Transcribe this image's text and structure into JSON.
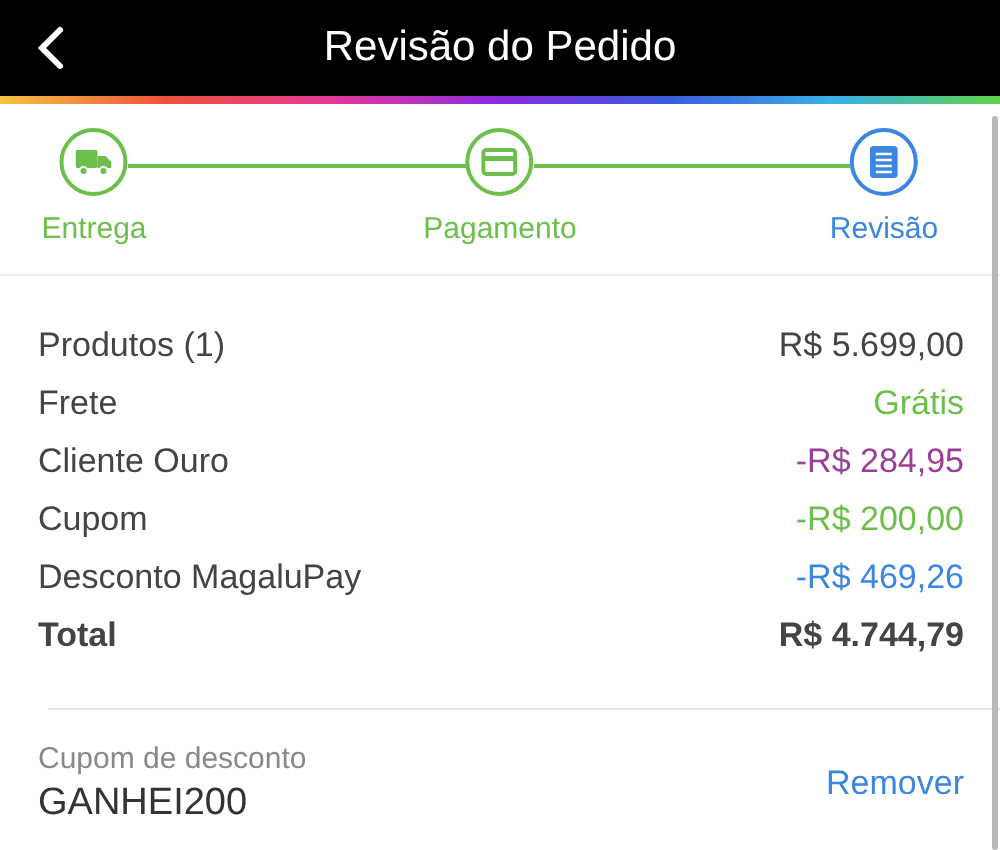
{
  "header": {
    "title": "Revisão do Pedido"
  },
  "steps": [
    {
      "label": "Entrega",
      "kind": "truck",
      "selected": false
    },
    {
      "label": "Pagamento",
      "kind": "card",
      "selected": false
    },
    {
      "label": "Revisão",
      "kind": "document",
      "selected": true
    }
  ],
  "summary": [
    {
      "label": "Produtos (1)",
      "value": "R$ 5.699,00",
      "color": "#444444",
      "kind": "line"
    },
    {
      "label": "Frete",
      "value": "Grátis",
      "color": "#6cbf4a",
      "kind": "line"
    },
    {
      "label": "Cliente Ouro",
      "value": "-R$ 284,95",
      "color": "#9a3e96",
      "kind": "line"
    },
    {
      "label": "Cupom",
      "value": "-R$ 200,00",
      "color": "#6cbf4a",
      "kind": "line"
    },
    {
      "label": "Desconto MagaluPay",
      "value": "-R$ 469,26",
      "color": "#3a86e0",
      "kind": "line"
    },
    {
      "label": "Total",
      "value": "R$ 4.744,79",
      "color": "#444444",
      "kind": "total"
    }
  ],
  "coupon": {
    "label": "Cupom de desconto",
    "code": "GANHEI200",
    "action": "Remover"
  }
}
